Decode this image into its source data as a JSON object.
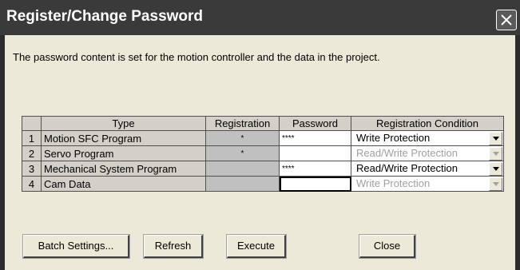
{
  "window": {
    "title": "Register/Change Password",
    "close_icon": "close-icon"
  },
  "message": "The password content is set for the motion controller and the data in the project.",
  "table": {
    "headers": [
      "",
      "Type",
      "Registration",
      "Password",
      "Registration Condition"
    ],
    "rows": [
      {
        "num": "1",
        "type": "Motion SFC Program",
        "registration": "*",
        "password": "****",
        "condition": "Write Protection",
        "condition_enabled": true
      },
      {
        "num": "2",
        "type": "Servo Program",
        "registration": "*",
        "password": "",
        "condition": "Read/Write Protection",
        "condition_enabled": false
      },
      {
        "num": "3",
        "type": "Mechanical System Program",
        "registration": "",
        "password": "****",
        "condition": "Read/Write Protection",
        "condition_enabled": true
      },
      {
        "num": "4",
        "type": "Cam Data",
        "registration": "",
        "password": "",
        "condition": "Write Protection",
        "condition_enabled": false
      }
    ]
  },
  "buttons": {
    "batch": "Batch Settings...",
    "refresh": "Refresh",
    "execute": "Execute",
    "close": "Close"
  },
  "colors": {
    "titlebar": "#3a3a3a",
    "dialog_bg": "#ece9d8",
    "disabled_text": "#a0a0a0"
  }
}
